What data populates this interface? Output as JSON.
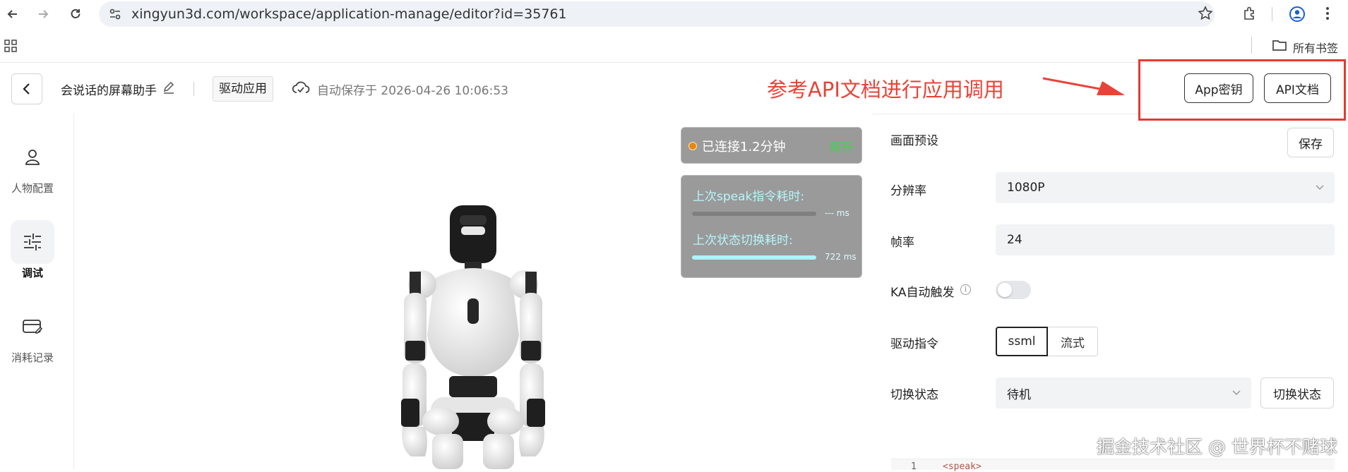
{
  "browser": {
    "url": "xingyun3d.com/workspace/application-manage/editor?id=35761",
    "bookmarks_label": "所有书签"
  },
  "header": {
    "app_title": "会说话的屏幕助手",
    "app_type": "驱动应用",
    "autosave_text": "自动保存于 2026-04-26 10:06:53",
    "annotation": "参考API文档进行应用调用",
    "appkey_label": "App密钥",
    "apidoc_label": "API文档"
  },
  "sidebar": {
    "items": [
      {
        "label": "人物配置",
        "icon": "person-icon"
      },
      {
        "label": "调试",
        "icon": "sliders-icon",
        "active": true
      },
      {
        "label": "消耗记录",
        "icon": "card-icon"
      }
    ]
  },
  "connection": {
    "status_text": "已连接1.2分钟",
    "disconnect_label": "断开",
    "dot_color": "#e8870c"
  },
  "metrics": {
    "speak_label": "上次speak指令耗时:",
    "speak_value": "--- ms",
    "switch_label": "上次状态切换耗时:",
    "switch_value": "722 ms",
    "switch_fill": 1.0,
    "speak_fill": 0.0
  },
  "settings": {
    "preset_label": "画面预设",
    "save_label": "保存",
    "resolution_label": "分辨率",
    "resolution_value": "1080P",
    "framerate_label": "帧率",
    "framerate_value": "24",
    "ka_label": "KA自动触发",
    "ka_enabled": false,
    "drive_label": "驱动指令",
    "drive_options": [
      "ssml",
      "流式"
    ],
    "drive_selected": "ssml",
    "state_label": "切换状态",
    "state_value": "待机",
    "switch_button": "切换状态"
  },
  "code": {
    "line_number": "1",
    "first_line": "<speak>"
  },
  "watermark": "掘金技术社区 @ 世界杯不赌球"
}
